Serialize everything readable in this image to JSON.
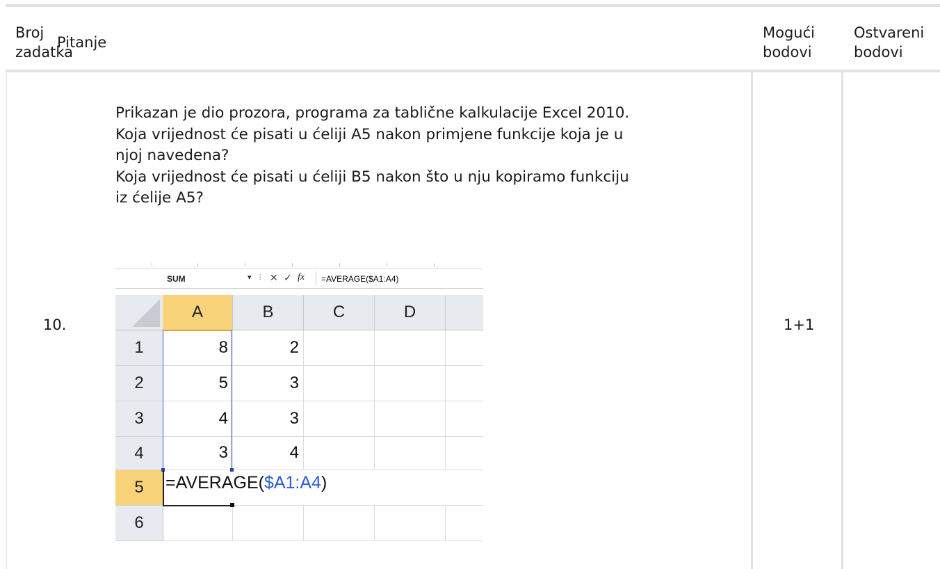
{
  "header": {
    "col1_line1": "Broj",
    "col1_line2": "zadatka",
    "col2": "Pitanje",
    "col3_line1": "Mogući",
    "col3_line2": "bodovi",
    "col4_line1": "Ostvareni",
    "col4_line2": "bodovi"
  },
  "row": {
    "number": "10.",
    "points": "1+1",
    "question_lines": [
      "Prikazan je dio prozora, programa za tablične kalkulacije Excel 2010.",
      "Koja vrijednost će pisati u ćeliji A5 nakon primjene funkcije koja je u",
      "njoj navedena?",
      "Koja vrijednost će pisati u ćeliji B5 nakon što u nju  kopiramo funkciju",
      "iz ćelije A5?"
    ]
  },
  "excel": {
    "name_box": "SUM",
    "formula_bar": "=AVERAGE($A1:A4)",
    "columns": [
      "A",
      "B",
      "C",
      "D"
    ],
    "rows": [
      "1",
      "2",
      "3",
      "4",
      "5",
      "6"
    ],
    "col_a": [
      "8",
      "5",
      "4",
      "3"
    ],
    "col_b": [
      "2",
      "3",
      "3",
      "4"
    ],
    "cell_a5_prefix": "=AVERAGE(",
    "cell_a5_ref": "$A1:A4",
    "cell_a5_suffix": ")"
  }
}
